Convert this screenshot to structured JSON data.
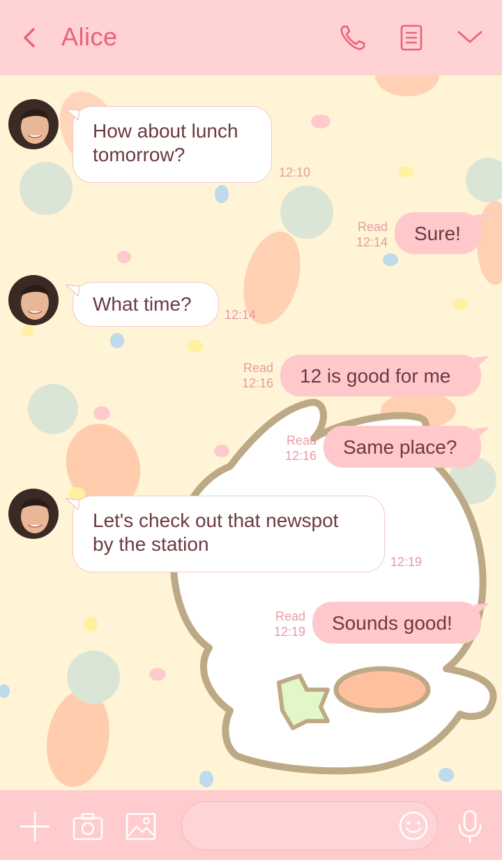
{
  "header": {
    "title": "Alice",
    "icons": [
      "back-arrow-icon",
      "phone-icon",
      "notes-icon",
      "chevron-down-icon"
    ]
  },
  "messages": [
    {
      "direction": "in",
      "lines": [
        "How about lunch",
        "tomorrow?"
      ],
      "time": "12:10"
    },
    {
      "direction": "out",
      "text": "Sure!",
      "read": "Read",
      "time": "12:14"
    },
    {
      "direction": "in",
      "lines": [
        "What time?"
      ],
      "time": "12:14"
    },
    {
      "direction": "out",
      "text": "12 is good for me",
      "read": "Read",
      "time": "12:16"
    },
    {
      "direction": "out",
      "text": "Same place?",
      "read": "Read",
      "time": "12:16"
    },
    {
      "direction": "in",
      "lines": [
        "Let's check out that newspot",
        "by the station"
      ],
      "time": "12:19"
    },
    {
      "direction": "out",
      "text": "Sounds good!",
      "read": "Read",
      "time": "12:19"
    }
  ],
  "footer": {
    "input_value": "",
    "icons": [
      "plus-icon",
      "camera-icon",
      "image-icon",
      "emoji-icon",
      "microphone-icon"
    ]
  },
  "colors": {
    "header_bg": "#ffd2d4",
    "accent": "#e8627a",
    "chat_bg": "#fff4d6",
    "outgoing_bubble": "#ffc9cc",
    "incoming_bubble": "#ffffff",
    "footer_bg": "#ffcccd"
  }
}
